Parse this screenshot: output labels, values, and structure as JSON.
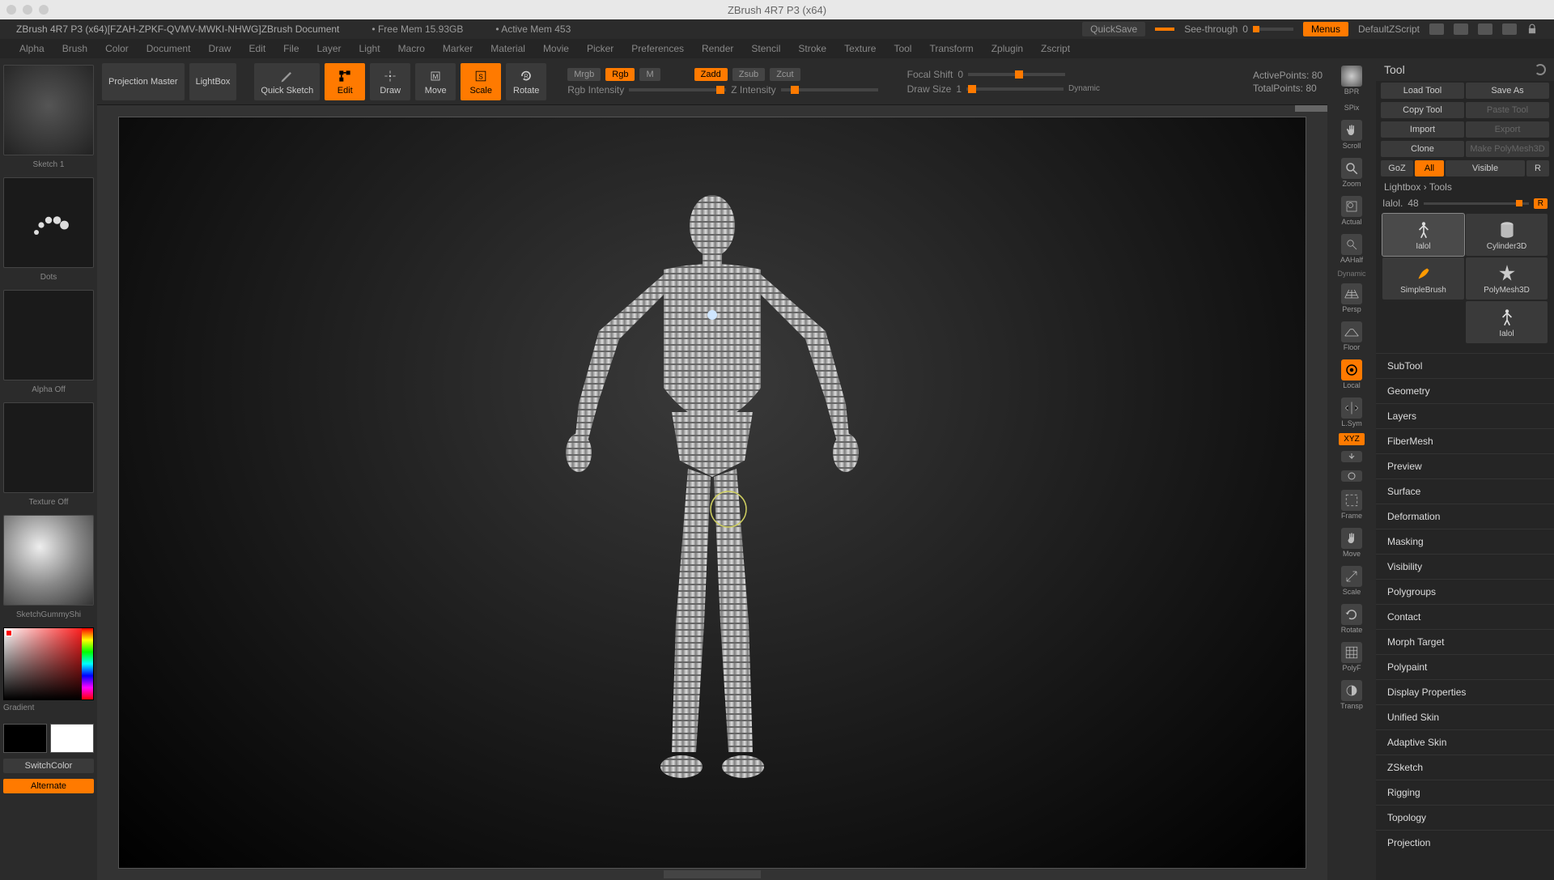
{
  "window": {
    "title": "ZBrush 4R7 P3 (x64)"
  },
  "docbar": {
    "doc_title": "ZBrush 4R7 P3 (x64)[FZAH-ZPKF-QVMV-MWKI-NHWG]ZBrush Document",
    "free_mem": "Free Mem 15.93GB",
    "active_mem": "Active Mem 453",
    "quicksave": "QuickSave",
    "seethrough_label": "See-through",
    "seethrough_val": "0",
    "menus": "Menus",
    "zscript": "DefaultZScript"
  },
  "menus": [
    "Alpha",
    "Brush",
    "Color",
    "Document",
    "Draw",
    "Edit",
    "File",
    "Layer",
    "Light",
    "Macro",
    "Marker",
    "Material",
    "Movie",
    "Picker",
    "Preferences",
    "Render",
    "Stencil",
    "Stroke",
    "Texture",
    "Tool",
    "Transform",
    "Zplugin",
    "Zscript"
  ],
  "toolbar": {
    "proj_master": "Projection Master",
    "lightbox": "LightBox",
    "quicksketch": "Quick Sketch",
    "edit": "Edit",
    "draw": "Draw",
    "move": "Move",
    "scale": "Scale",
    "rotate": "Rotate",
    "mrgb": "Mrgb",
    "rgb": "Rgb",
    "m": "M",
    "zadd": "Zadd",
    "zsub": "Zsub",
    "zcut": "Zcut",
    "rgb_intensity": "Rgb Intensity",
    "z_intensity": "Z Intensity",
    "focal_label": "Focal Shift",
    "focal_val": "0",
    "drawsize_label": "Draw Size",
    "drawsize_val": "1",
    "dynamic": "Dynamic",
    "active_pts": "ActivePoints: 80",
    "total_pts": "TotalPoints: 80"
  },
  "shelf": {
    "sketch": "Sketch 1",
    "dots": "Dots",
    "alpha_off": "Alpha Off",
    "texture_off": "Texture Off",
    "material": "SketchGummyShi",
    "gradient": "Gradient",
    "switch": "SwitchColor",
    "alternate": "Alternate"
  },
  "rightstrip": {
    "bpr": "BPR",
    "spix": "SPix",
    "scroll": "Scroll",
    "zoom": "Zoom",
    "actual": "Actual",
    "aahalf": "AAHalf",
    "persp": "Persp",
    "floor": "Floor",
    "local": "Local",
    "lsym": "L.Sym",
    "xyz": "XYZ",
    "frame": "Frame",
    "move": "Move",
    "scale": "Scale",
    "rotate": "Rotate",
    "polyf": "PolyF",
    "transp": "Transp",
    "dynamic": "Dynamic"
  },
  "rightpanel": {
    "title": "Tool",
    "load_tool": "Load Tool",
    "save_as": "Save As",
    "copy_tool": "Copy Tool",
    "paste_tool": "Paste Tool",
    "import": "Import",
    "export": "Export",
    "clone": "Clone",
    "make_polymesh": "Make PolyMesh3D",
    "goz": "GoZ",
    "all": "All",
    "visible": "Visible",
    "r": "R",
    "breadcrumb": "Lightbox › Tools",
    "slider_label": "Ialol.",
    "slider_val": "48",
    "tiles": {
      "t0": "Ialol",
      "t1": "Cylinder3D",
      "t2": "SimpleBrush",
      "t3": "PolyMesh3D",
      "t4": "Ialol"
    },
    "sections": [
      "SubTool",
      "Geometry",
      "Layers",
      "FiberMesh",
      "Preview",
      "Surface",
      "Deformation",
      "Masking",
      "Visibility",
      "Polygroups",
      "Contact",
      "Morph Target",
      "Polypaint",
      "Display Properties",
      "Unified Skin",
      "Adaptive Skin",
      "ZSketch",
      "Rigging",
      "Topology",
      "Projection"
    ]
  }
}
